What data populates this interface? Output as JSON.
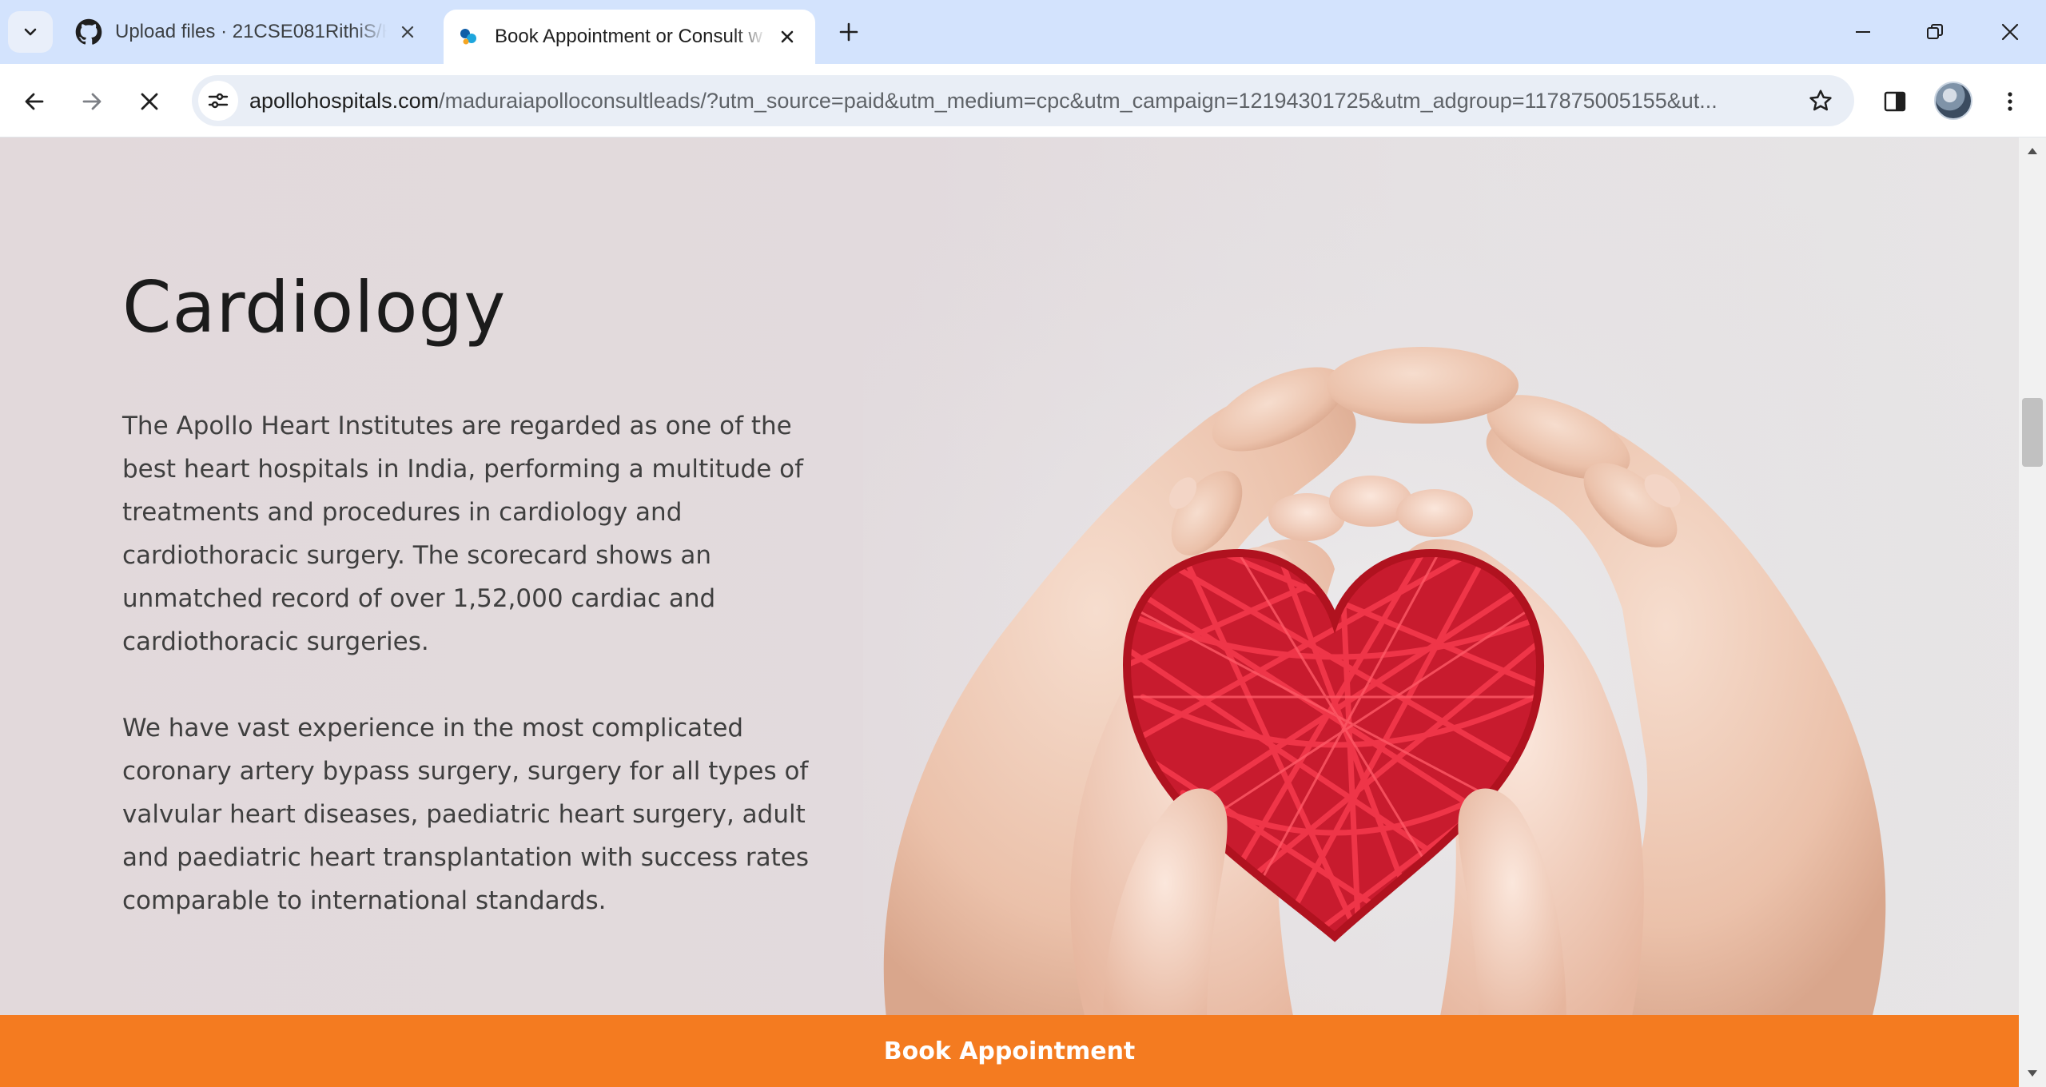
{
  "browser": {
    "tabs": [
      {
        "title": "Upload files · 21CSE081RithiS/H",
        "favicon": "github-icon",
        "active": false
      },
      {
        "title": "Book Appointment or Consult w",
        "favicon": "apollo-icon",
        "active": true
      }
    ],
    "address": {
      "host": "apollohospitals.com",
      "path": "/maduraiapolloconsultleads/?utm_source=paid&utm_medium=cpc&utm_campaign=12194301725&utm_adgroup=117875005155&ut..."
    },
    "icons": {
      "tab_search": "chevron-down-icon",
      "new_tab": "plus-icon",
      "back": "arrow-left-icon",
      "forward": "arrow-right-icon",
      "stop": "close-icon",
      "site_info": "tune-icon",
      "bookmark": "star-icon",
      "side_panel": "side-panel-icon",
      "menu": "kebab-menu-icon"
    }
  },
  "page": {
    "title": "Cardiology",
    "paragraphs": [
      "The Apollo Heart Institutes are regarded as one of the best heart hospitals in India, performing a multitude of treatments and procedures in cardiology and cardiothoracic surgery. The scorecard shows an unmatched record of over 1,52,000 cardiac and cardiothoracic surgeries.",
      "We have vast experience in the most complicated coronary artery bypass surgery, surgery for all types of valvular heart diseases, paediatric heart surgery, adult and paediatric heart transplantation with success rates comparable to international standards."
    ],
    "cta_label": "Book Appointment",
    "colors": {
      "cta": "#f47b20",
      "heart": "#e8283f"
    }
  }
}
